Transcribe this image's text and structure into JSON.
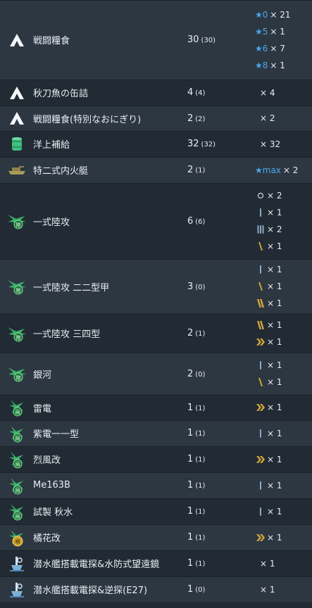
{
  "rows": [
    {
      "icon": "ration-icon",
      "name": "戦闘糧食",
      "count": "30",
      "count_sub": "(30)",
      "h": 113,
      "improvements": [
        {
          "kind": "star",
          "level": "0",
          "mult": "× 21"
        },
        {
          "kind": "star",
          "level": "5",
          "mult": "× 1"
        },
        {
          "kind": "star",
          "level": "6",
          "mult": "× 7"
        },
        {
          "kind": "star",
          "level": "8",
          "mult": "× 1"
        }
      ]
    },
    {
      "icon": "ration-icon",
      "name": "秋刀魚の缶詰",
      "count": "4",
      "count_sub": "(4)",
      "h": 37,
      "improvements": [
        {
          "kind": "plain",
          "mult": "× 4"
        }
      ]
    },
    {
      "icon": "ration-icon",
      "name": "戦闘糧食(特別なおにぎり)",
      "count": "2",
      "count_sub": "(2)",
      "h": 36,
      "improvements": [
        {
          "kind": "plain",
          "mult": "× 2"
        }
      ]
    },
    {
      "icon": "supply-drum-icon",
      "name": "洋上補給",
      "count": "32",
      "count_sub": "(32)",
      "h": 37,
      "improvements": [
        {
          "kind": "plain",
          "mult": "× 32"
        }
      ]
    },
    {
      "icon": "landing-craft-icon",
      "name": "特二式内火艇",
      "count": "2",
      "count_sub": "(1)",
      "h": 37,
      "improvements": [
        {
          "kind": "star",
          "level": "max",
          "mult": "× 2"
        }
      ]
    },
    {
      "icon": "land-attacker-icon",
      "name": "一式陸攻",
      "count": "6",
      "count_sub": "(6)",
      "h": 108,
      "improvements": [
        {
          "kind": "prof",
          "prof": "0",
          "mult": "× 2"
        },
        {
          "kind": "prof",
          "prof": "1",
          "mult": "× 1"
        },
        {
          "kind": "prof",
          "prof": "3",
          "mult": "× 2"
        },
        {
          "kind": "prof",
          "prof": "4",
          "mult": "× 1"
        }
      ]
    },
    {
      "icon": "land-attacker-icon",
      "name": "一式陸攻 二二型甲",
      "count": "3",
      "count_sub": "(0)",
      "h": 78,
      "improvements": [
        {
          "kind": "prof",
          "prof": "1",
          "mult": "× 1"
        },
        {
          "kind": "prof",
          "prof": "4",
          "mult": "× 1"
        },
        {
          "kind": "prof",
          "prof": "5",
          "mult": "× 1"
        }
      ]
    },
    {
      "icon": "land-attacker-icon",
      "name": "一式陸攻 三四型",
      "count": "2",
      "count_sub": "(1)",
      "h": 55,
      "improvements": [
        {
          "kind": "prof",
          "prof": "5",
          "mult": "× 1"
        },
        {
          "kind": "prof",
          "prof": "7",
          "mult": "× 1"
        }
      ]
    },
    {
      "icon": "land-attacker-icon",
      "name": "銀河",
      "count": "2",
      "count_sub": "(0)",
      "h": 60,
      "improvements": [
        {
          "kind": "prof",
          "prof": "1",
          "mult": "× 1"
        },
        {
          "kind": "prof",
          "prof": "4",
          "mult": "× 1"
        }
      ]
    },
    {
      "icon": "interceptor-icon",
      "name": "雷電",
      "count": "1",
      "count_sub": "(1)",
      "h": 36,
      "improvements": [
        {
          "kind": "prof",
          "prof": "7",
          "mult": "× 1"
        }
      ]
    },
    {
      "icon": "interceptor-icon",
      "name": "紫電一一型",
      "count": "1",
      "count_sub": "(1)",
      "h": 37,
      "improvements": [
        {
          "kind": "prof",
          "prof": "1",
          "mult": "× 1"
        }
      ]
    },
    {
      "icon": "interceptor-icon",
      "name": "烈風改",
      "count": "1",
      "count_sub": "(1)",
      "h": 37,
      "improvements": [
        {
          "kind": "prof",
          "prof": "7",
          "mult": "× 1"
        }
      ]
    },
    {
      "icon": "interceptor-icon",
      "name": "Me163B",
      "count": "1",
      "count_sub": "(1)",
      "h": 37,
      "improvements": [
        {
          "kind": "prof",
          "prof": "1",
          "mult": "× 1"
        }
      ]
    },
    {
      "icon": "interceptor-icon",
      "name": "試製 秋水",
      "count": "1",
      "count_sub": "(1)",
      "h": 37,
      "improvements": [
        {
          "kind": "prof",
          "prof": "1",
          "mult": "× 1"
        }
      ]
    },
    {
      "icon": "jet-bomber-icon",
      "name": "橘花改",
      "count": "1",
      "count_sub": "(1)",
      "h": 37,
      "improvements": [
        {
          "kind": "prof",
          "prof": "7",
          "mult": "× 1"
        }
      ]
    },
    {
      "icon": "submarine-equipment-icon",
      "name": "潜水艦搭載電探&水防式望遠鏡",
      "count": "1",
      "count_sub": "(1)",
      "h": 37,
      "improvements": [
        {
          "kind": "plain",
          "mult": "× 1"
        }
      ]
    },
    {
      "icon": "submarine-equipment-icon",
      "name": "潜水艦搭載電探&逆探(E27)",
      "count": "1",
      "count_sub": "(0)",
      "h": 37,
      "improvements": [
        {
          "kind": "plain",
          "mult": "× 1"
        }
      ]
    }
  ],
  "colors": {
    "row_odd": "#2d3741",
    "row_even": "#222b34",
    "star": "#4aa8ee",
    "prof_blue": "#8aa9c6",
    "prof_gold": "#d4a63c"
  }
}
